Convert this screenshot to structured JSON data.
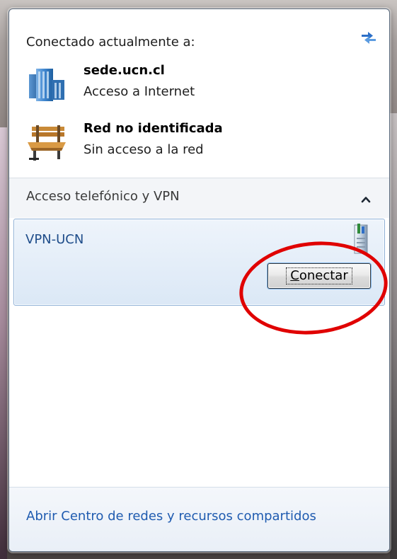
{
  "header": {
    "title": "Conectado actualmente a:",
    "refresh_icon": "network-refresh-icon"
  },
  "connected_networks": [
    {
      "name": "sede.ucn.cl",
      "status": "Acceso a Internet",
      "icon": "domain-network-icon"
    },
    {
      "name": "Red no identificada",
      "status": "Sin acceso a la red",
      "icon": "public-network-bench-icon"
    }
  ],
  "dialup_vpn": {
    "title": "Acceso telefónico y VPN",
    "expanded": true,
    "items": [
      {
        "name": "VPN-UCN",
        "icon": "vpn-connection-icon",
        "action_label": "Conectar"
      }
    ]
  },
  "footer": {
    "link_label": "Abrir Centro de redes y recursos compartidos"
  },
  "colors": {
    "link": "#1f5bb0",
    "selection_bg": "#dbe8f6",
    "selection_border": "#8fb0d6",
    "annotation": "#e00000"
  }
}
